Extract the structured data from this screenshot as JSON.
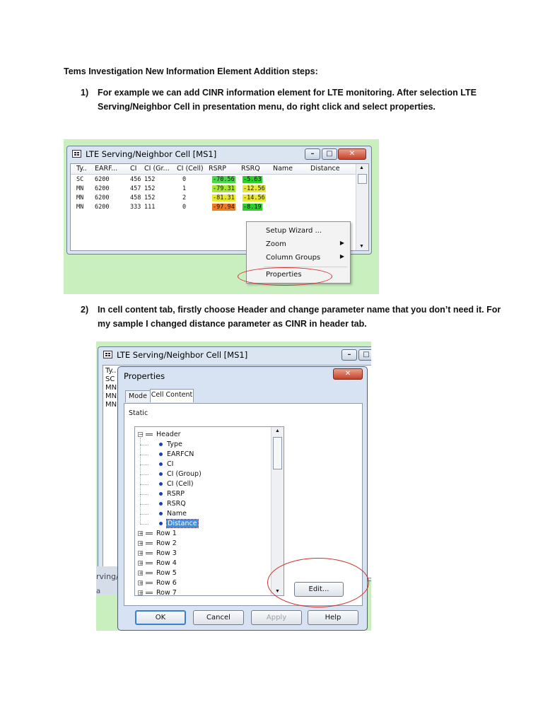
{
  "document": {
    "heading": "Tems Investigation New Information Element Addition steps:",
    "step1": {
      "number": "1)",
      "line1": "For example we can add CINR information element for LTE monitoring. After selection LTE",
      "line2": "Serving/Neighbor Cell in presentation menu, do right click and select properties."
    },
    "step2": {
      "number": "2)",
      "line1": "In cell content tab, firstly choose Header and change parameter name that you don’t need it. For",
      "line2": "my sample I changed distance parameter as CINR in header tab."
    }
  },
  "screenshot1": {
    "window_title": "LTE Serving/Neighbor Cell [MS1]",
    "columns": [
      "Ty..",
      "EARF...",
      "CI",
      "CI (Gr...",
      "CI (Cell)",
      "RSRP",
      "RSRQ",
      "Name",
      "Distance"
    ],
    "rows": [
      {
        "type": "SC",
        "earfcn": "6200",
        "ci": "456",
        "ci_group": "152",
        "ci_cell": "0",
        "rsrp": "-70.56",
        "rsrq": "-5.63"
      },
      {
        "type": "MN",
        "earfcn": "6200",
        "ci": "457",
        "ci_group": "152",
        "ci_cell": "1",
        "rsrp": "-79.31",
        "rsrq": "-12.56"
      },
      {
        "type": "MN",
        "earfcn": "6200",
        "ci": "458",
        "ci_group": "152",
        "ci_cell": "2",
        "rsrp": "-81.31",
        "rsrq": "-14.56"
      },
      {
        "type": "MN",
        "earfcn": "6200",
        "ci": "333",
        "ci_group": "111",
        "ci_cell": "0",
        "rsrp": "-97.94",
        "rsrq": "-8.19"
      }
    ],
    "rsrp_colors": [
      "#4cd64c",
      "#a6e830",
      "#e8e830",
      "#f07a20"
    ],
    "rsrq_colors": [
      "#28d028",
      "#e8e830",
      "#e8e830",
      "#28d028"
    ],
    "context_menu": {
      "items": [
        {
          "label": "Setup Wizard ...",
          "submenu": false
        },
        {
          "label": "Zoom",
          "submenu": true
        },
        {
          "label": "Column Groups",
          "submenu": true
        },
        {
          "label": "Properties",
          "submenu": false
        }
      ]
    },
    "background_color": "#c9efbf",
    "highlight_color": "#d0302a"
  },
  "screenshot2": {
    "background_window_title": "LTE Serving/Neighbor Cell [MS1]",
    "background_rows": [
      "Ty..",
      "SC",
      "MN",
      "MN",
      "MN"
    ],
    "background_tab_fragment": "rving/A",
    "background_fragment2": "a",
    "dialog_title": "Properties",
    "tabs": [
      "Mode",
      "Cell Content"
    ],
    "static_label": "Static",
    "tree": {
      "header": "Header",
      "header_children": [
        "Type",
        "EARFCN",
        "CI",
        "CI (Group)",
        "CI (Cell)",
        "RSRP",
        "RSRQ",
        "Name",
        "Distance"
      ],
      "selected_child": "Distance",
      "rows": [
        "Row 1",
        "Row 2",
        "Row 3",
        "Row 4",
        "Row 5",
        "Row 6",
        "Row 7"
      ]
    },
    "edit_button": "Edit...",
    "footer_buttons": [
      "OK",
      "Cancel",
      "Apply",
      "Help"
    ]
  }
}
